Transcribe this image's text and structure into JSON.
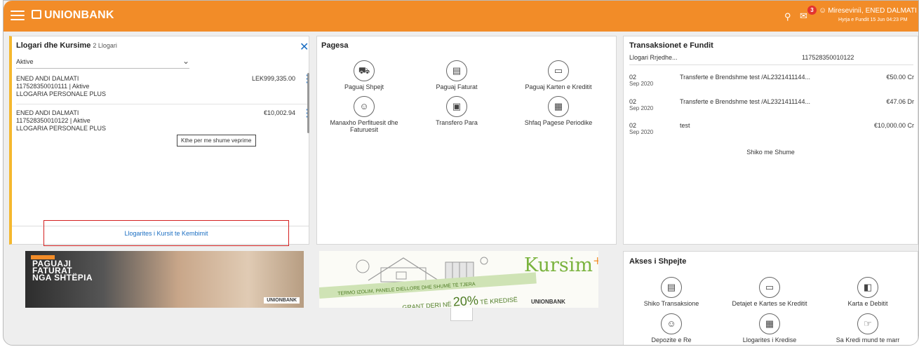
{
  "header": {
    "brand": "UNIONBANK",
    "notification_count": "3",
    "user_greeting": "Mireseviniì, ENED DALMATI",
    "last_login": "Hyrja e Fundit 15 Jun 04:23 PM"
  },
  "accounts": {
    "title": "Llogari dhe Kursime",
    "count": "2 Llogari",
    "filter": "Aktive",
    "items": [
      {
        "name": "ENED ANDI DALMATI",
        "number": "117528350010111 | Aktive",
        "type": "LLOGARIA PERSONALE PLUS",
        "balance": "LEK999,335.00"
      },
      {
        "name": "ENED ANDI DALMATI",
        "number": "117528350010122 | Aktive",
        "type": "LLOGARIA PERSONALE PLUS",
        "balance": "€10,002.94"
      }
    ],
    "tooltip": "Kthe per me shume veprime",
    "exchange_link": "Llogarites i Kursit te Kembimit"
  },
  "payments": {
    "title": "Pagesa",
    "items": [
      {
        "label": "Paguaj Shpejt",
        "icon": "fast-payment-icon"
      },
      {
        "label": "Paguaj Faturat",
        "icon": "bill-icon"
      },
      {
        "label": "Paguaj Karten e Kreditit",
        "icon": "credit-card-icon"
      },
      {
        "label": "Manaxho Perfituesit dhe Faturuesit",
        "icon": "beneficiary-icon"
      },
      {
        "label": "Transfero Para",
        "icon": "money-transfer-icon"
      },
      {
        "label": "Shfaq Pagese Periodike",
        "icon": "calendar-icon"
      }
    ]
  },
  "transactions": {
    "title": "Transaksionet e Fundit",
    "account_label": "Llogari Rrjedhe...",
    "account_number": "117528350010122",
    "rows": [
      {
        "day": "02",
        "month": "Sep 2020",
        "desc": "Transferte e Brendshme test /AL2321411144...",
        "amount": "€50.00 Cr"
      },
      {
        "day": "02",
        "month": "Sep 2020",
        "desc": "Transferte e Brendshme test /AL2321411144...",
        "amount": "€47.06 Dr"
      },
      {
        "day": "02",
        "month": "Sep 2020",
        "desc": "test",
        "amount": "€10,000.00 Cr"
      }
    ],
    "more": "Shiko me Shume"
  },
  "banners": {
    "b1_lines": [
      "PAGUAJI",
      "FATURAT",
      "NGA SHTËPIA"
    ],
    "b1_logo": "UNIONBANK",
    "b2_brand": "Kursim",
    "b2_promo": "TERMO IZOLIM, PANELE DIELLORE DHE SHUMË TË TJERA",
    "b2_grant": "GRANT DERI NË",
    "b2_pct": "20%",
    "b2_pct_suffix": "TË KREDISË",
    "b2_logo": "UNIONBANK"
  },
  "quick": {
    "title": "Akses i Shpejte",
    "items": [
      {
        "label": "Shiko Transaksione",
        "icon": "transactions-icon"
      },
      {
        "label": "Detajet e Kartes se Kreditit",
        "icon": "card-details-icon"
      },
      {
        "label": "Karta e Debitit",
        "icon": "debit-card-icon"
      },
      {
        "label": "Depozite e Re",
        "icon": "deposit-icon"
      },
      {
        "label": "Llogarites i Kredise",
        "icon": "loan-calculator-icon"
      },
      {
        "label": "Sa Kredi mund te marr",
        "icon": "loan-eligibility-icon"
      }
    ]
  }
}
